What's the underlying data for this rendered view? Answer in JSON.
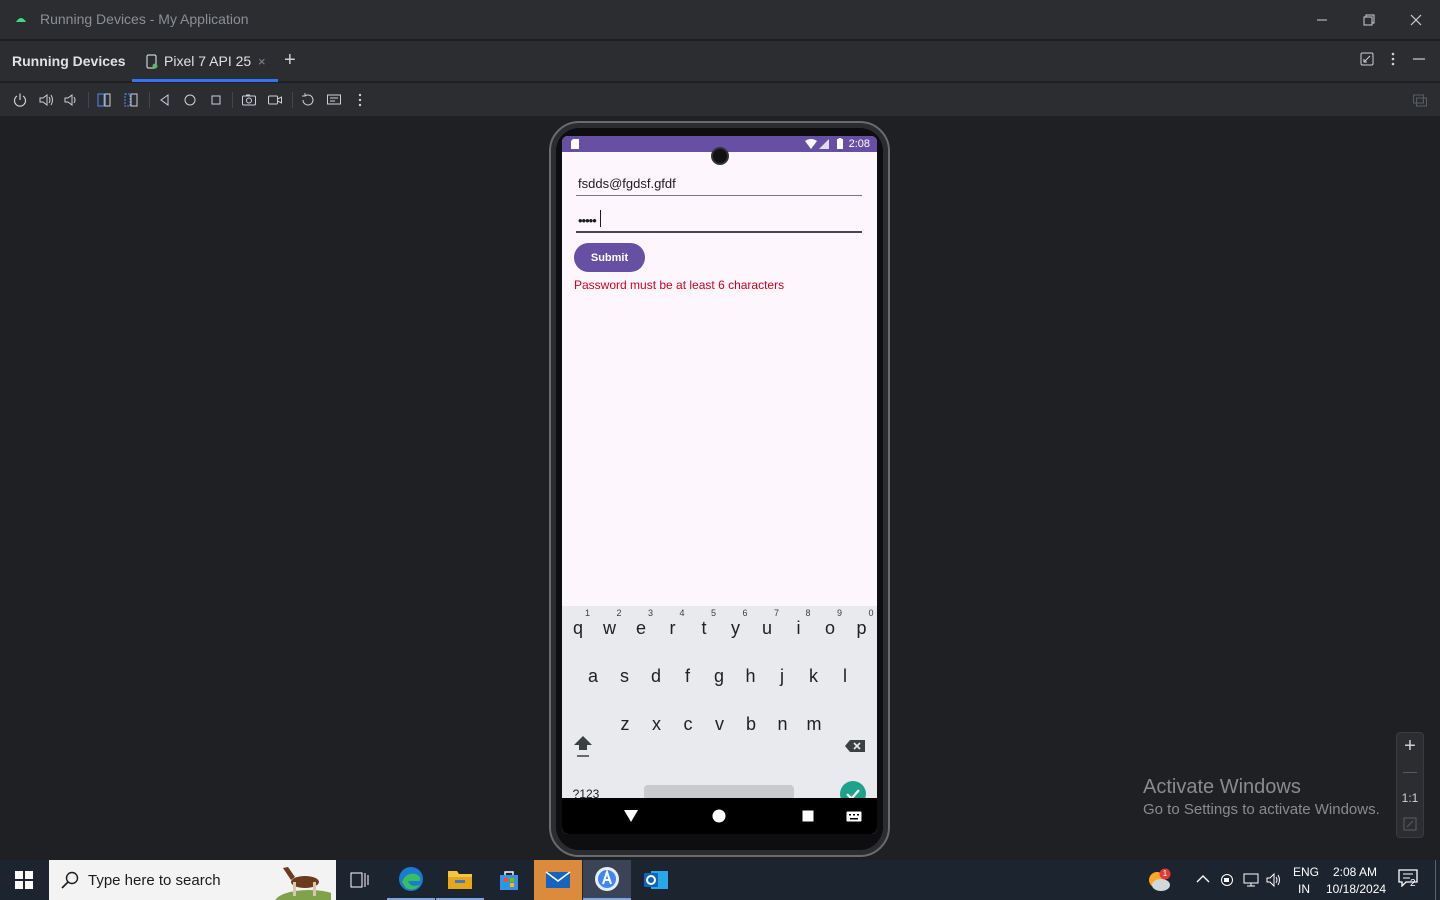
{
  "window": {
    "title": "Running Devices - My Application"
  },
  "tabbar": {
    "tool_title": "Running Devices",
    "active_tab": "Pixel 7 API 25",
    "close_glyph": "×",
    "add_glyph": "+"
  },
  "device": {
    "status_time": "2:08",
    "email_value": "fsdds@fgdsf.gfdf",
    "password_value": "•••••",
    "submit_label": "Submit",
    "error_text": "Password must be at least 6 characters"
  },
  "keyboard": {
    "row1": [
      {
        "key": "q",
        "hint": "1"
      },
      {
        "key": "w",
        "hint": "2"
      },
      {
        "key": "e",
        "hint": "3"
      },
      {
        "key": "r",
        "hint": "4"
      },
      {
        "key": "t",
        "hint": "5"
      },
      {
        "key": "y",
        "hint": "6"
      },
      {
        "key": "u",
        "hint": "7"
      },
      {
        "key": "i",
        "hint": "8"
      },
      {
        "key": "o",
        "hint": "9"
      },
      {
        "key": "p",
        "hint": "0"
      }
    ],
    "row2": [
      "a",
      "s",
      "d",
      "f",
      "g",
      "h",
      "j",
      "k",
      "l"
    ],
    "row3": [
      "z",
      "x",
      "c",
      "v",
      "b",
      "n",
      "m"
    ],
    "symbols_label": "?123",
    "comma": ",",
    "period": "."
  },
  "zoom": {
    "zoom_in": "+",
    "zoom_out": "—",
    "actual_size": "1:1"
  },
  "watermark": {
    "line1": "Activate Windows",
    "line2": "Go to Settings to activate Windows."
  },
  "taskbar": {
    "search_placeholder": "Type here to search",
    "language": "ENG",
    "region": "IN",
    "time": "2:08 AM",
    "date": "10/18/2024",
    "notification_count": "2",
    "badge_count": "1"
  },
  "colors": {
    "accent": "#3574f0",
    "device_primary": "#6750a4",
    "error": "#d0021b",
    "confirm_key": "#1fa28b"
  }
}
